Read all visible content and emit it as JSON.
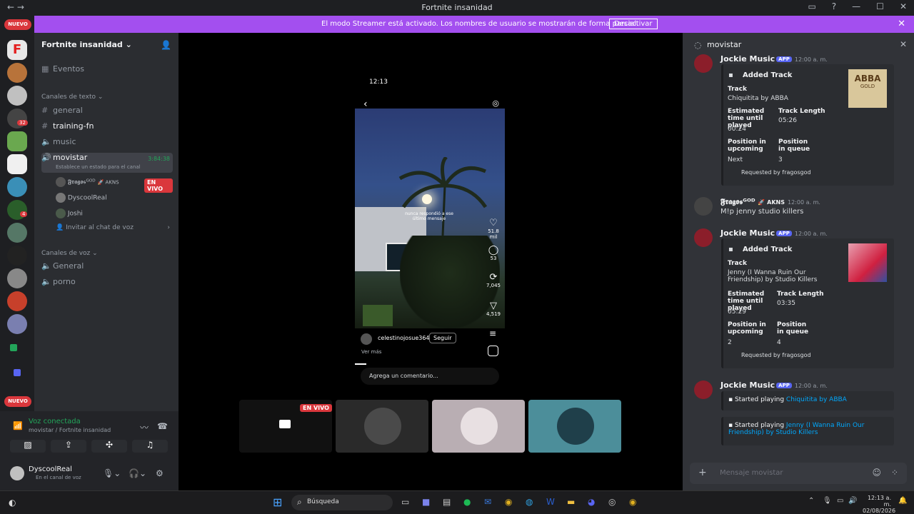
{
  "window": {
    "title": "Fortnite insanidad",
    "nav": "←  →"
  },
  "streamer_bar": {
    "message": "El modo Streamer está activado. Los nombres de usuario se mostrarán de forma parcial.",
    "button": "Desactivar",
    "close": "✕"
  },
  "guilds": {
    "new_badge_top": "NUEVO",
    "new_badge_bottom": "NUEVO",
    "notif_1": "32",
    "notif_2": "4"
  },
  "sidebar": {
    "server_name": "Fortnite insanidad",
    "events": "Eventos",
    "text_category": "Canales de texto",
    "text_channels": [
      "general",
      "training-fn",
      "music"
    ],
    "voice_active": "movistar",
    "voice_active_timer": "3:84:38",
    "voice_active_status": "Establece un estado para el canal",
    "members": [
      {
        "name": "𝕱𝖗𝖆𝖌𝖔𝖘ᴳᴼᴰ",
        "tag": "🚀 AKNS",
        "badge": "EN VIVO"
      },
      {
        "name": "DyscoolReal",
        "tag": "",
        "badge": ""
      },
      {
        "name": "Joshi",
        "tag": "",
        "badge": ""
      }
    ],
    "invite": "Invitar al chat de voz",
    "voice_category": "Canales de voz",
    "voice_channels": [
      "General",
      "porno"
    ]
  },
  "voice_panel": {
    "status": "Voz conectada",
    "location": "movistar / Fortnite insanidad"
  },
  "user_panel": {
    "name": "DyscoolReal",
    "status": "En el canal de voz"
  },
  "stream": {
    "time": "12:13",
    "caption_line1": "nunca respondió a ese",
    "caption_line2": "último mensaje",
    "likes": "51.8 mil",
    "comments": "53",
    "reposts": "7,045",
    "shares": "4,519",
    "username": "celestinojosue364",
    "follow": "Seguir",
    "see_more": "Ver más",
    "comment_placeholder": "Agrega un comentario..."
  },
  "tiles": {
    "live_badge": "EN VIVO"
  },
  "chat": {
    "channel": "movistar",
    "input_placeholder": "Mensaje movistar",
    "bot_name": "Jockie Music",
    "app_badge": "APP",
    "time_bot": "12:00 a. m.",
    "embed_title": "Added Track",
    "track_label": "Track",
    "time_label": "Estimated time until played",
    "length_label": "Track Length",
    "upcoming_label": "Position in upcoming",
    "queue_label": "Position in queue",
    "requested_by": "Requested by fragosgod",
    "embed1": {
      "track": "Chiquitita by ABBA",
      "time": "00:24",
      "length": "05:26",
      "upcoming": "Next",
      "queue": "3",
      "art": "ABBA",
      "art_sub": "GOLD"
    },
    "user_msg": {
      "name": "𝕱𝖗𝖆𝖌𝖔𝖘ᴳᴼᴰ",
      "tag": "🚀 AKNS",
      "time": "12:00 a. m.",
      "text": "M!p jenny studio killers"
    },
    "embed2": {
      "track": "Jenny (I Wanna Ruin Our Friendship) by Studio Killers",
      "time": "05:29",
      "length": "03:35",
      "upcoming": "2",
      "queue": "4"
    },
    "started_prefix": "Started playing",
    "started1": "Chiquitita by ABBA",
    "started2": "Jenny (I Wanna Ruin Our Friendship) by Studio Killers"
  },
  "taskbar": {
    "search": "Búsqueda",
    "time": "12:13 a. m.",
    "date": "02/08/2026"
  }
}
